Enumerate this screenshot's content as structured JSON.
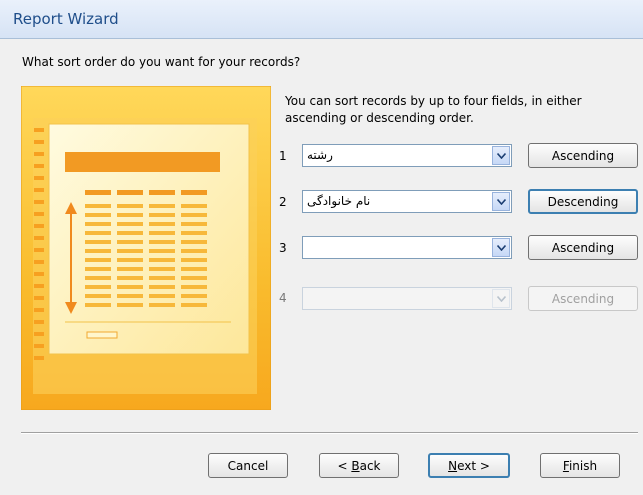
{
  "window": {
    "title": "Report Wizard"
  },
  "question": "What sort order do you want for your records?",
  "instructions": "You can sort records by up to four fields, in either ascending or descending order.",
  "sort_rows": [
    {
      "num": "1",
      "field": "رشته",
      "order": "Ascending",
      "enabled": true
    },
    {
      "num": "2",
      "field": "نام خانوادگی",
      "order": "Descending",
      "enabled": true,
      "focused": true
    },
    {
      "num": "3",
      "field": "",
      "order": "Ascending",
      "enabled": true
    },
    {
      "num": "4",
      "field": "",
      "order": "Ascending",
      "enabled": false
    }
  ],
  "buttons": {
    "cancel": "Cancel",
    "back_mnemonic": "B",
    "back_rest": "ack",
    "back_prefix": "< ",
    "next_mnemonic": "N",
    "next_rest": "ext >",
    "finish_mnemonic": "F",
    "finish_rest": "inish"
  },
  "colors": {
    "accent_blue": "#1f4e8a",
    "illustration_orange": "#f7b52b",
    "illustration_light": "#fff2b8",
    "focus_border": "#3c7fb1"
  }
}
